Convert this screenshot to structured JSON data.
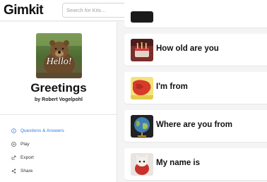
{
  "header": {
    "logo": "Gimkit",
    "search_placeholder": "Search for Kits..."
  },
  "kit": {
    "cover_caption": "Hello!",
    "title": "Greetings",
    "author": "by Robert Vogelpohl"
  },
  "menu": [
    {
      "label": "Questions & Answers",
      "icon": "info-circle-icon",
      "active": true
    },
    {
      "label": "Play",
      "icon": "play-circle-icon",
      "active": false
    },
    {
      "label": "Export",
      "icon": "export-icon",
      "active": false
    },
    {
      "label": "Share",
      "icon": "share-icon",
      "active": false
    }
  ],
  "questions": [
    {
      "text": ""
    },
    {
      "text": "How old are you"
    },
    {
      "text": "I'm from"
    },
    {
      "text": "Where are you from"
    },
    {
      "text": "My name is"
    }
  ],
  "colors": {
    "accent": "#2f7de1",
    "background": "#f4f4f5"
  }
}
